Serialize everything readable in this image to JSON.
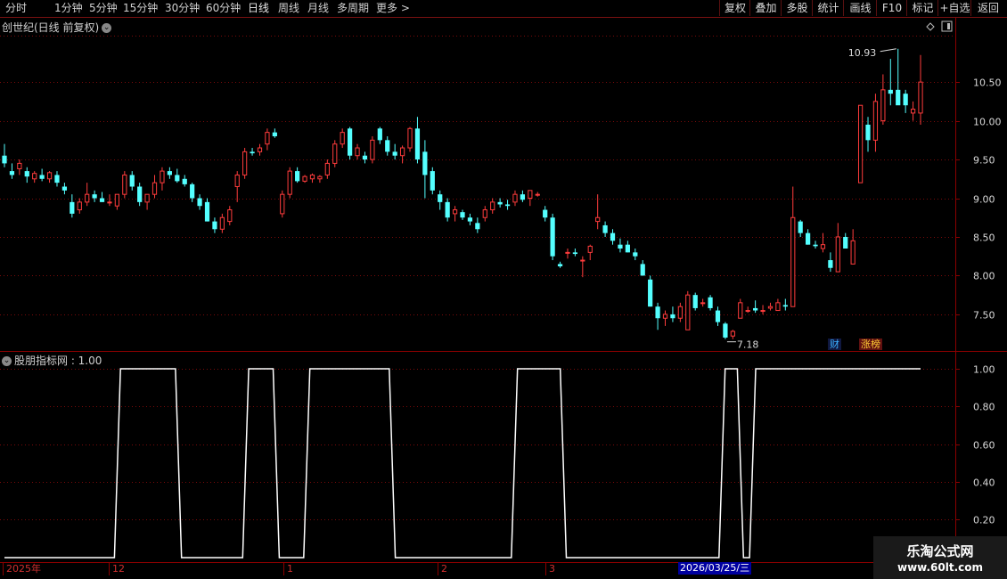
{
  "toolbar": {
    "periods": [
      {
        "label": "分时",
        "active": false
      },
      {
        "label": "1分钟",
        "active": false
      },
      {
        "label": "5分钟",
        "active": false
      },
      {
        "label": "15分钟",
        "active": false
      },
      {
        "label": "30分钟",
        "active": false
      },
      {
        "label": "60分钟",
        "active": false
      },
      {
        "label": "日线",
        "active": true
      },
      {
        "label": "周线",
        "active": false
      },
      {
        "label": "月线",
        "active": false
      },
      {
        "label": "多周期",
        "active": false
      },
      {
        "label": "更多 >",
        "active": false
      }
    ],
    "buttons": [
      "复权",
      "叠加",
      "多股",
      "统计",
      "画线",
      "F10",
      "标记",
      "+自选",
      "返回"
    ]
  },
  "chart": {
    "title": "创世纪(日线 前复权)",
    "high_label": "10.93",
    "low_label": "7.18",
    "badge_cai": "财",
    "badge_zhang": "涨榜"
  },
  "indicator": {
    "title": "股朋指标网 : 1.00"
  },
  "date_axis": {
    "labels": [
      "2025年",
      "12",
      "1",
      "2",
      "3"
    ],
    "cursor_date": "2026/03/25/三"
  },
  "watermark": {
    "title": "乐淘公式网",
    "url": "www.60lt.com"
  },
  "colors": {
    "up": "#ff3c3c",
    "down": "#54ffff",
    "grid": "#7a0a0a",
    "axis_text": "#d8d8d8",
    "indicator_line": "#ffffff"
  },
  "chart_data": [
    {
      "type": "candlestick",
      "title": "创世纪(日线 前复权)",
      "yticks": [
        7.5,
        8.0,
        8.5,
        9.0,
        9.5,
        10.0,
        10.5
      ],
      "ylim": [
        7.05,
        11.1
      ],
      "grid": true,
      "candles": [
        [
          9.55,
          9.7,
          9.4,
          9.45
        ],
        [
          9.35,
          9.45,
          9.25,
          9.3
        ],
        [
          9.38,
          9.5,
          9.3,
          9.45
        ],
        [
          9.35,
          9.4,
          9.2,
          9.28
        ],
        [
          9.25,
          9.35,
          9.2,
          9.32
        ],
        [
          9.3,
          9.38,
          9.22,
          9.25
        ],
        [
          9.25,
          9.35,
          9.2,
          9.33
        ],
        [
          9.3,
          9.35,
          9.15,
          9.2
        ],
        [
          9.15,
          9.2,
          9.05,
          9.1
        ],
        [
          8.95,
          9.05,
          8.75,
          8.8
        ],
        [
          8.85,
          9.0,
          8.8,
          8.95
        ],
        [
          8.95,
          9.2,
          8.9,
          9.05
        ],
        [
          9.05,
          9.1,
          8.95,
          9.0
        ],
        [
          9.0,
          9.08,
          8.95,
          8.95
        ],
        [
          8.95,
          9.05,
          8.9,
          8.95
        ],
        [
          8.9,
          9.0,
          8.85,
          9.05
        ],
        [
          9.05,
          9.35,
          9.0,
          9.3
        ],
        [
          9.3,
          9.35,
          9.1,
          9.15
        ],
        [
          9.15,
          9.2,
          8.9,
          8.95
        ],
        [
          8.95,
          9.05,
          8.85,
          9.05
        ],
        [
          9.05,
          9.3,
          9.0,
          9.2
        ],
        [
          9.2,
          9.4,
          9.1,
          9.35
        ],
        [
          9.35,
          9.4,
          9.25,
          9.3
        ],
        [
          9.3,
          9.38,
          9.2,
          9.22
        ],
        [
          9.25,
          9.3,
          9.15,
          9.18
        ],
        [
          9.18,
          9.2,
          8.95,
          9.0
        ],
        [
          9.0,
          9.05,
          8.85,
          8.9
        ],
        [
          8.95,
          9.0,
          8.7,
          8.7
        ],
        [
          8.7,
          8.75,
          8.55,
          8.6
        ],
        [
          8.6,
          8.8,
          8.55,
          8.75
        ],
        [
          8.7,
          8.9,
          8.65,
          8.85
        ],
        [
          9.15,
          9.35,
          8.95,
          9.3
        ],
        [
          9.3,
          9.65,
          9.25,
          9.6
        ],
        [
          9.6,
          9.65,
          9.55,
          9.58
        ],
        [
          9.6,
          9.7,
          9.55,
          9.65
        ],
        [
          9.7,
          9.9,
          9.62,
          9.85
        ],
        [
          9.85,
          9.9,
          9.78,
          9.8
        ],
        [
          8.8,
          9.1,
          8.75,
          9.05
        ],
        [
          9.05,
          9.4,
          9.0,
          9.35
        ],
        [
          9.35,
          9.4,
          9.2,
          9.22
        ],
        [
          9.22,
          9.3,
          9.2,
          9.28
        ],
        [
          9.25,
          9.32,
          9.2,
          9.3
        ],
        [
          9.25,
          9.3,
          9.2,
          9.28
        ],
        [
          9.3,
          9.5,
          9.25,
          9.45
        ],
        [
          9.45,
          9.75,
          9.4,
          9.7
        ],
        [
          9.7,
          9.9,
          9.65,
          9.85
        ],
        [
          9.9,
          9.92,
          9.5,
          9.55
        ],
        [
          9.55,
          9.7,
          9.5,
          9.65
        ],
        [
          9.55,
          9.6,
          9.45,
          9.5
        ],
        [
          9.5,
          9.8,
          9.45,
          9.75
        ],
        [
          9.9,
          9.92,
          9.7,
          9.75
        ],
        [
          9.75,
          9.8,
          9.55,
          9.6
        ],
        [
          9.6,
          9.7,
          9.5,
          9.55
        ],
        [
          9.55,
          9.68,
          9.45,
          9.65
        ],
        [
          9.65,
          9.92,
          9.6,
          9.9
        ],
        [
          9.9,
          10.05,
          9.45,
          9.5
        ],
        [
          9.6,
          9.75,
          9.0,
          9.3
        ],
        [
          9.35,
          9.4,
          9.05,
          9.1
        ],
        [
          9.05,
          9.1,
          8.85,
          8.95
        ],
        [
          8.95,
          9.0,
          8.7,
          8.75
        ],
        [
          8.8,
          8.9,
          8.7,
          8.85
        ],
        [
          8.82,
          8.85,
          8.72,
          8.75
        ],
        [
          8.75,
          8.8,
          8.65,
          8.7
        ],
        [
          8.68,
          8.75,
          8.55,
          8.6
        ],
        [
          8.75,
          8.9,
          8.7,
          8.85
        ],
        [
          8.85,
          9.0,
          8.8,
          8.95
        ],
        [
          8.95,
          9.0,
          8.88,
          8.92
        ],
        [
          8.92,
          8.98,
          8.85,
          8.9
        ],
        [
          8.95,
          9.1,
          8.9,
          9.05
        ],
        [
          9.05,
          9.1,
          8.95,
          8.98
        ],
        [
          9.0,
          9.1,
          8.9,
          9.1
        ],
        [
          9.05,
          9.08,
          9.02,
          9.05
        ],
        [
          8.85,
          8.9,
          8.7,
          8.75
        ],
        [
          8.75,
          8.8,
          8.2,
          8.25
        ],
        [
          8.15,
          8.18,
          8.1,
          8.12
        ],
        [
          8.3,
          8.35,
          8.22,
          8.3
        ],
        [
          8.3,
          8.35,
          8.25,
          8.28
        ],
        [
          8.2,
          8.25,
          7.98,
          8.2
        ],
        [
          8.3,
          8.4,
          8.2,
          8.38
        ],
        [
          8.7,
          9.05,
          8.6,
          8.75
        ],
        [
          8.65,
          8.7,
          8.5,
          8.55
        ],
        [
          8.55,
          8.6,
          8.4,
          8.45
        ],
        [
          8.4,
          8.48,
          8.3,
          8.35
        ],
        [
          8.4,
          8.45,
          8.3,
          8.3
        ],
        [
          8.3,
          8.35,
          8.2,
          8.25
        ],
        [
          8.15,
          8.2,
          8.0,
          8.0
        ],
        [
          7.95,
          8.0,
          7.6,
          7.6
        ],
        [
          7.6,
          7.65,
          7.3,
          7.45
        ],
        [
          7.45,
          7.55,
          7.35,
          7.5
        ],
        [
          7.5,
          7.6,
          7.4,
          7.45
        ],
        [
          7.45,
          7.65,
          7.4,
          7.6
        ],
        [
          7.3,
          7.8,
          7.3,
          7.75
        ],
        [
          7.75,
          7.78,
          7.55,
          7.58
        ],
        [
          7.65,
          7.7,
          7.6,
          7.65
        ],
        [
          7.72,
          7.75,
          7.55,
          7.58
        ],
        [
          7.55,
          7.6,
          7.35,
          7.4
        ],
        [
          7.38,
          7.4,
          7.18,
          7.2
        ],
        [
          7.22,
          7.3,
          7.18,
          7.28
        ],
        [
          7.45,
          7.7,
          7.45,
          7.65
        ],
        [
          7.55,
          7.6,
          7.52,
          7.55
        ],
        [
          7.58,
          7.68,
          7.52,
          7.55
        ],
        [
          7.55,
          7.62,
          7.5,
          7.55
        ],
        [
          7.58,
          7.65,
          7.55,
          7.6
        ],
        [
          7.55,
          7.7,
          7.55,
          7.65
        ],
        [
          7.62,
          7.7,
          7.55,
          7.6
        ],
        [
          7.6,
          9.15,
          7.6,
          8.75
        ],
        [
          8.7,
          8.72,
          8.5,
          8.55
        ],
        [
          8.55,
          8.6,
          8.4,
          8.4
        ],
        [
          8.4,
          8.45,
          8.35,
          8.38
        ],
        [
          8.35,
          8.55,
          8.3,
          8.4
        ],
        [
          8.2,
          8.3,
          8.05,
          8.1
        ],
        [
          8.05,
          8.68,
          8.05,
          8.5
        ],
        [
          8.5,
          8.55,
          8.35,
          8.35
        ],
        [
          8.15,
          8.6,
          8.15,
          8.45
        ],
        [
          9.2,
          10.2,
          9.2,
          10.2
        ],
        [
          9.95,
          10.05,
          9.6,
          9.75
        ],
        [
          9.75,
          10.35,
          9.6,
          10.25
        ],
        [
          10.0,
          10.6,
          9.95,
          10.4
        ],
        [
          10.4,
          10.8,
          10.2,
          10.35
        ],
        [
          10.4,
          10.93,
          10.25,
          10.2
        ],
        [
          10.35,
          10.4,
          10.1,
          10.2
        ],
        [
          10.1,
          10.25,
          10.0,
          10.15
        ],
        [
          10.1,
          10.85,
          9.95,
          10.5
        ]
      ]
    },
    {
      "type": "line",
      "title": "股朋指标网",
      "yticks": [
        0.2,
        0.4,
        0.6,
        0.8,
        1.0
      ],
      "ylim": [
        0,
        1.04
      ],
      "series": [
        {
          "values": [
            0,
            0,
            0,
            0,
            0,
            0,
            0,
            0,
            0,
            0,
            0,
            0,
            0,
            0,
            0,
            0,
            0,
            0,
            0,
            1,
            1,
            1,
            1,
            1,
            1,
            1,
            1,
            1,
            1,
            0,
            0,
            0,
            0,
            0,
            0,
            0,
            0,
            0,
            0,
            0,
            1,
            1,
            1,
            1,
            1,
            0,
            0,
            0,
            0,
            0,
            1,
            1,
            1,
            1,
            1,
            1,
            1,
            1,
            1,
            1,
            1,
            1,
            1,
            1,
            0,
            0,
            0,
            0,
            0,
            0,
            0,
            0,
            0,
            0,
            0,
            0,
            0,
            0,
            0,
            0,
            0,
            0,
            0,
            0,
            1,
            1,
            1,
            1,
            1,
            1,
            1,
            1,
            0,
            0,
            0,
            0,
            0,
            0,
            0,
            0,
            0,
            0,
            0,
            0,
            0,
            0,
            0,
            0,
            0,
            0,
            0,
            0,
            0,
            0,
            0,
            0,
            0,
            0,
            1,
            1,
            1,
            0,
            0,
            1,
            1,
            1,
            1,
            1,
            1,
            1,
            1,
            1,
            1,
            1,
            1,
            1,
            1,
            1,
            1,
            1,
            1,
            1,
            1,
            1,
            1,
            1,
            1,
            1,
            1,
            1,
            1
          ]
        }
      ]
    }
  ]
}
